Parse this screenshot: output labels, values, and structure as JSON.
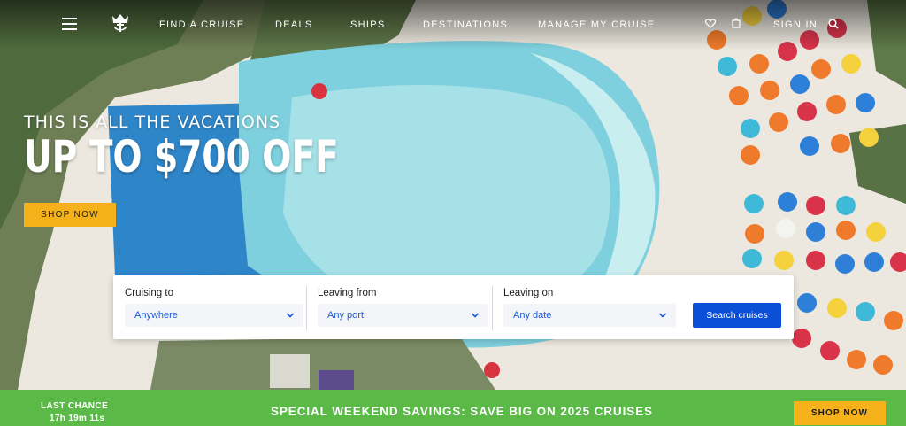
{
  "nav": {
    "menu_icon": "hamburger-menu-icon",
    "logo_icon": "crown-anchor-logo-icon",
    "links": [
      "FIND A CRUISE",
      "DEALS",
      "SHIPS",
      "DESTINATIONS",
      "MANAGE MY CRUISE"
    ],
    "favorites_icon": "heart-icon",
    "cart_icon": "shopping-bag-icon",
    "sign_in": "SIGN IN",
    "search_icon": "search-icon"
  },
  "hero": {
    "eyebrow": "THIS IS ALL THE VACATIONS",
    "headline": "UP TO $700 OFF",
    "cta": "SHOP NOW"
  },
  "search": {
    "fields": [
      {
        "label": "Cruising to",
        "value": "Anywhere"
      },
      {
        "label": "Leaving from",
        "value": "Any port"
      },
      {
        "label": "Leaving on",
        "value": "Any date"
      }
    ],
    "button": "Search cruises",
    "dropdown_icon": "chevron-down-icon"
  },
  "promo": {
    "last_chance": "LAST CHANCE",
    "countdown": "17h 19m 11s",
    "message": "SPECIAL WEEKEND SAVINGS: SAVE BIG ON 2025 CRUISES",
    "cta": "SHOP NOW"
  },
  "colors": {
    "accent_yellow": "#f5b119",
    "search_blue": "#0a4fd6",
    "link_blue": "#1a5bd6",
    "promo_green": "#5bb948"
  }
}
